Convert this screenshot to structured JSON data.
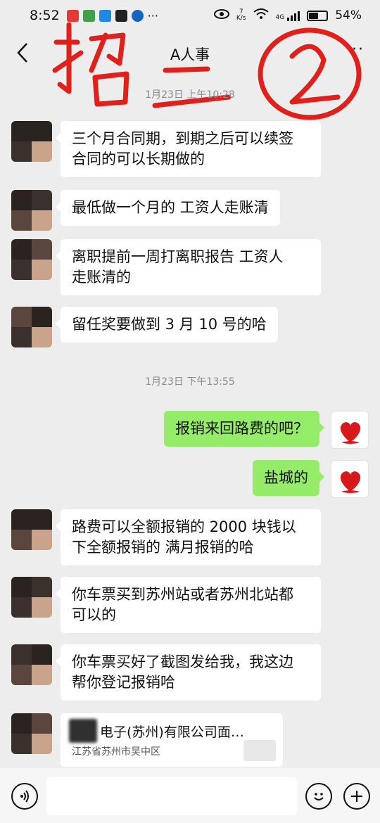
{
  "status_bar": {
    "time": "8:52",
    "speed_value": "7",
    "speed_unit": "K/s",
    "network": "4G",
    "battery": "54%",
    "battery_level": 0.54
  },
  "header": {
    "title": "A人事",
    "more": "⋮"
  },
  "annotation": {
    "handwriting_text": "招二 ②",
    "color": "#e0201b"
  },
  "messages": [
    {
      "type": "timestamp",
      "text": "1月23日 上午10:28"
    },
    {
      "type": "left",
      "text_lines": [
        "三个月合同期，到期之后可以续签",
        "合同的可以长期做的"
      ]
    },
    {
      "type": "left",
      "text_lines": [
        "最低做一个月的 工资人走账清"
      ]
    },
    {
      "type": "left",
      "text_lines": [
        "离职提前一周打离职报告 工资人",
        "走账清的"
      ]
    },
    {
      "type": "left",
      "text_lines": [
        "留任奖要做到 3 月 10 号的哈"
      ]
    },
    {
      "type": "timestamp",
      "text": "1月23日 下午13:55"
    },
    {
      "type": "right",
      "text_lines": [
        "报销来回路费的吧？"
      ]
    },
    {
      "type": "right",
      "text_lines": [
        "盐城的"
      ]
    },
    {
      "type": "left",
      "text_lines": [
        "路费可以全额报销的 2000 块钱以",
        "下全额报销的  满月报销的哈"
      ]
    },
    {
      "type": "left",
      "text_lines": [
        "你车票买到苏州站或者苏州北站都",
        "可以的"
      ]
    },
    {
      "type": "left",
      "text_lines": [
        "你车票买好了截图发给我，我这边",
        "帮你登记报销哈"
      ]
    },
    {
      "type": "card",
      "title": "电子(苏州)有限公司面…",
      "subtitle": "江苏省苏州市吴中区"
    }
  ],
  "input": {
    "placeholder": ""
  },
  "colors": {
    "background": "#ededed",
    "incoming_bubble": "#ffffff",
    "outgoing_bubble": "#95ec69",
    "annotation_red": "#e0201b"
  },
  "icons": {
    "back": "chevron-left-icon",
    "voice": "voice-icon",
    "emoji": "emoji-icon",
    "plus": "plus-icon",
    "self_avatar": "heart-icon"
  }
}
